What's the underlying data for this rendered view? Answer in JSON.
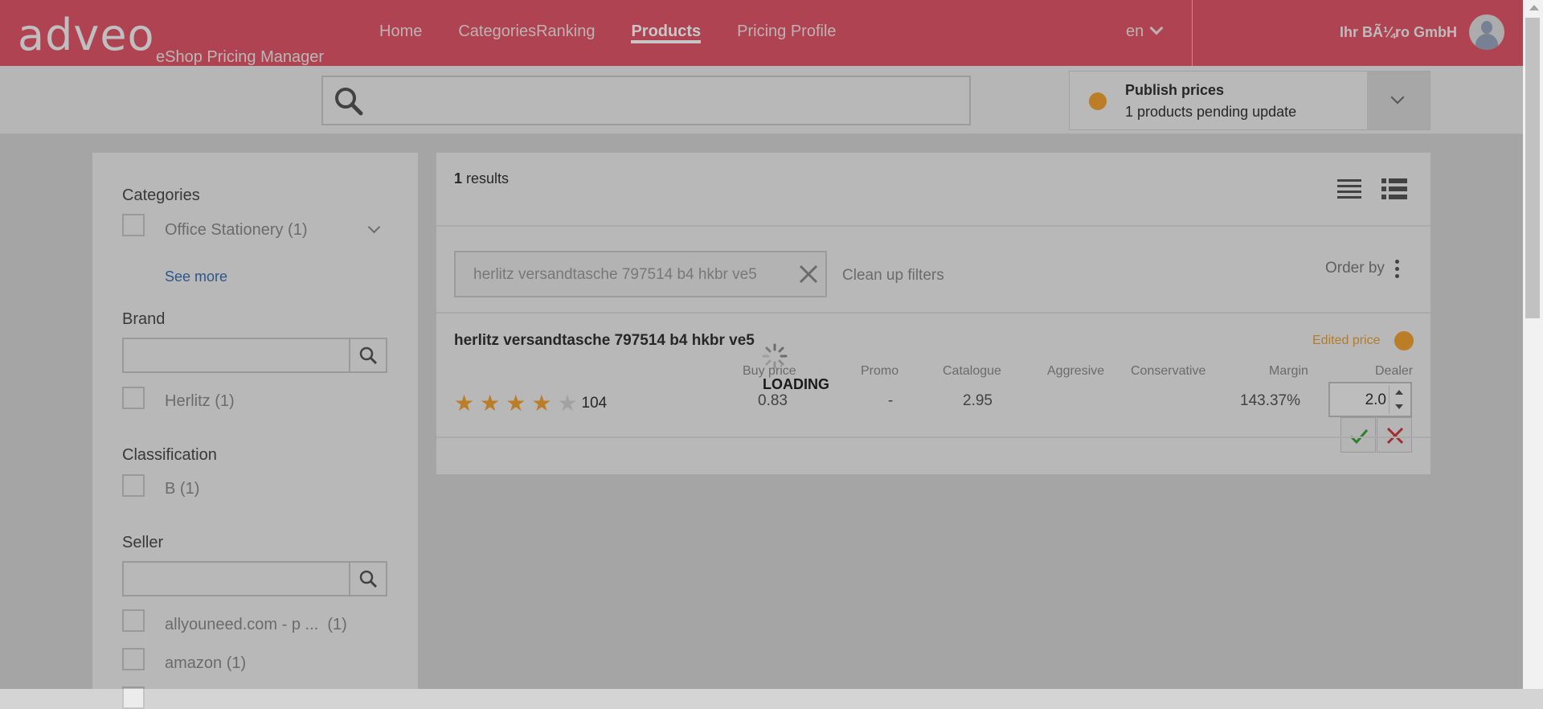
{
  "app": {
    "logo": "adveo",
    "subtitle": "eShop Pricing Manager",
    "nav": [
      "Home",
      "CategoriesRanking",
      "Products",
      "Pricing Profile"
    ],
    "active_nav": "Products",
    "language": "en",
    "user": "Ihr BÃ¼ro GmbH",
    "brand_color": "#e0566a"
  },
  "search": {
    "placeholder": ""
  },
  "publish": {
    "title": "Publish prices",
    "subtitle": "1 products pending update",
    "status_color": "#f0a030"
  },
  "sidebar": {
    "categories": {
      "title": "Categories",
      "items": [
        {
          "label": "Office Stationery",
          "count": "(1)"
        }
      ],
      "see_more": "See more"
    },
    "brand": {
      "title": "Brand",
      "items": [
        {
          "label": "Herlitz",
          "count": "(1)"
        }
      ]
    },
    "classification": {
      "title": "Classification",
      "items": [
        {
          "label": "B",
          "count": "(1)"
        }
      ]
    },
    "seller": {
      "title": "Seller",
      "items": [
        {
          "label": "allyouneed.com - p ...",
          "count": "(1)"
        },
        {
          "label": "amazon",
          "count": "(1)"
        }
      ]
    }
  },
  "results": {
    "count": "1",
    "count_label": "results",
    "filter_chip": "herlitz versandtasche 797514 b4 hkbr ve5",
    "clean_up": "Clean up filters",
    "order_by": "Order by",
    "loading_text": "LOADING",
    "product": {
      "name": "herlitz versandtasche 797514 b4 hkbr ve5",
      "edited_label": "Edited price",
      "rating": 4,
      "rating_max": 5,
      "reviews": "104",
      "columns": [
        "Buy price",
        "Promo",
        "Catalogue",
        "Aggresive",
        "Conservative",
        "Margin",
        "Dealer"
      ],
      "values": {
        "buy_price": "0.83",
        "promo": "-",
        "catalogue": "2.95",
        "aggresive": "",
        "conservative": "",
        "margin": "143.37%",
        "dealer": "2.0"
      }
    }
  }
}
